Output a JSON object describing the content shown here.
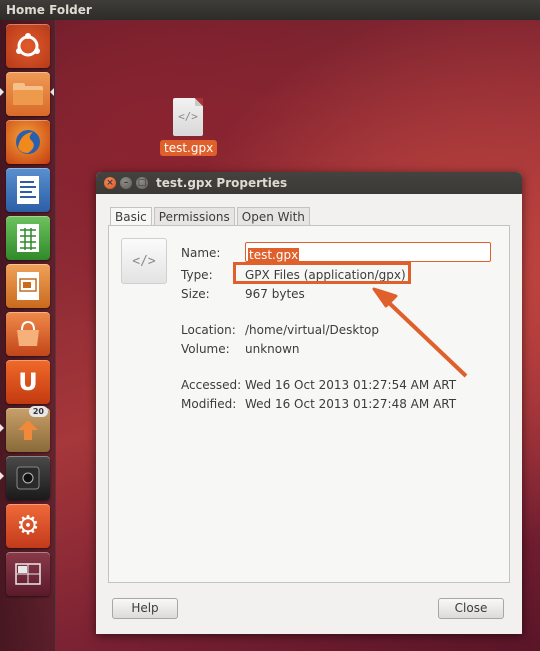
{
  "panel": {
    "title": "Home Folder"
  },
  "launcher": {
    "items": [
      {
        "name": "dash",
        "glyph": "◎"
      },
      {
        "name": "files",
        "glyph": ""
      },
      {
        "name": "firefox",
        "glyph": ""
      },
      {
        "name": "writer",
        "glyph": "≡"
      },
      {
        "name": "calc",
        "glyph": "▦"
      },
      {
        "name": "impress",
        "glyph": "▣"
      },
      {
        "name": "software-center",
        "glyph": ""
      },
      {
        "name": "ubuntu-one",
        "glyph": "U"
      },
      {
        "name": "update-manager",
        "glyph": "⇧",
        "badge": "20"
      },
      {
        "name": "camera",
        "glyph": "◉"
      },
      {
        "name": "system-settings",
        "glyph": "⚙"
      },
      {
        "name": "workspaces",
        "glyph": "▤"
      }
    ]
  },
  "desktop": {
    "file_label": "test.gpx",
    "file_glyph": "</>"
  },
  "window": {
    "title": "test.gpx Properties",
    "tabs": [
      "Basic",
      "Permissions",
      "Open With"
    ],
    "icon_glyph": "</>",
    "fields": {
      "name_label": "Name:",
      "name_value": "test.gpx",
      "type_label": "Type:",
      "type_value": "GPX Files (application/gpx)",
      "size_label": "Size:",
      "size_value": "967 bytes",
      "location_label": "Location:",
      "location_value": "/home/virtual/Desktop",
      "volume_label": "Volume:",
      "volume_value": "unknown",
      "accessed_label": "Accessed:",
      "accessed_value": "Wed 16 Oct 2013 01:27:54 AM ART",
      "modified_label": "Modified:",
      "modified_value": "Wed 16 Oct 2013 01:27:48 AM ART"
    },
    "buttons": {
      "help": "Help",
      "close": "Close"
    }
  },
  "colors": {
    "accent": "#e0602c",
    "panel": "#3a3935"
  }
}
